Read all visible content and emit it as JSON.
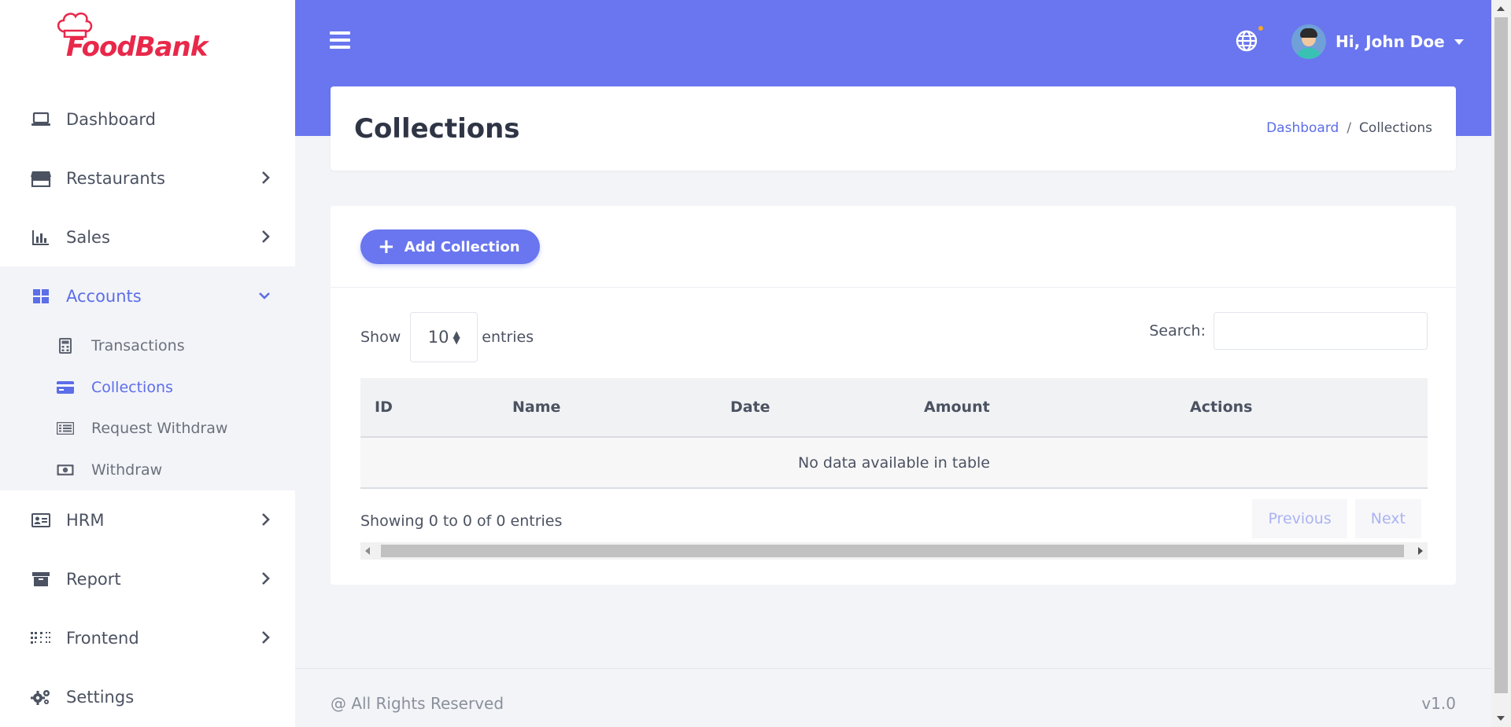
{
  "brand": {
    "logo_text": "FoodBank",
    "primary": "#6976ef",
    "logo_color": "#e8284a"
  },
  "sidebar": {
    "items": [
      {
        "label": "Dashboard",
        "icon": "laptop-icon"
      },
      {
        "label": "Restaurants",
        "icon": "store-icon"
      },
      {
        "label": "Sales",
        "icon": "bar-chart-icon"
      },
      {
        "label": "Accounts",
        "icon": "grid-icon"
      },
      {
        "label": "HRM",
        "icon": "id-card-icon"
      },
      {
        "label": "Report",
        "icon": "archive-icon"
      },
      {
        "label": "Frontend",
        "icon": "dots-icon"
      },
      {
        "label": "Settings",
        "icon": "gears-icon"
      }
    ],
    "accounts_sub": [
      {
        "label": "Transactions",
        "icon": "calculator-icon"
      },
      {
        "label": "Collections",
        "icon": "credit-card-icon"
      },
      {
        "label": "Request Withdraw",
        "icon": "list-icon"
      },
      {
        "label": "Withdraw",
        "icon": "money-bill-icon"
      }
    ]
  },
  "topbar": {
    "user_greeting": "Hi, John Doe"
  },
  "header": {
    "title": "Collections",
    "breadcrumb": {
      "home": "Dashboard",
      "separator": "/",
      "current": "Collections"
    }
  },
  "main": {
    "add_button": "Add Collection",
    "show_label": "Show",
    "entries_value": "10",
    "entries_label": "entries",
    "search_label": "Search:",
    "search_value": "",
    "table": {
      "columns": [
        "ID",
        "Name",
        "Date",
        "Amount",
        "Actions"
      ],
      "empty_message": "No data available in table"
    },
    "showing_text": "Showing 0 to 0 of 0 entries",
    "pagination": {
      "previous": "Previous",
      "next": "Next"
    }
  },
  "footer": {
    "copyright": "@ All Rights Reserved",
    "version": "v1.0"
  }
}
